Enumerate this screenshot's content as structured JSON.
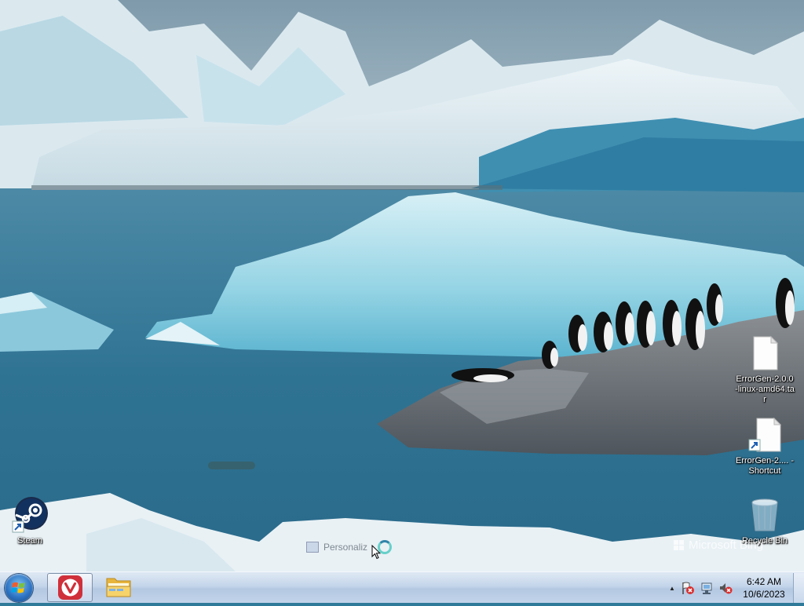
{
  "desktop": {
    "icons": [
      {
        "label": "ErrorGen-2.0.0-linux-amd64.tar",
        "icon": "file-icon"
      },
      {
        "label": "ErrorGen-2.... - Shortcut",
        "icon": "file-shortcut-icon"
      },
      {
        "label": "Steam",
        "icon": "steam-icon"
      },
      {
        "label": "Recycle Bin",
        "icon": "recycle-bin-icon"
      }
    ],
    "watermark": "Microsoft Bing",
    "ghost_text": "Personaliz"
  },
  "taskbar": {
    "start_icon": "windows-start-icon",
    "pinned": [
      {
        "name": "vivaldi",
        "icon": "vivaldi-icon"
      },
      {
        "name": "file-explorer",
        "icon": "folder-icon"
      }
    ],
    "tray": {
      "icons": [
        "show-hidden-icons-arrow",
        "action-center-flag-icon",
        "network-icon",
        "volume-muted-icon"
      ],
      "time": "6:42 AM",
      "date": "10/6/2023"
    }
  },
  "colors": {
    "vivaldi_red": "#d0303a",
    "taskbar_top": "#dfe9f4",
    "taskbar_bottom": "#c3d4ea"
  }
}
